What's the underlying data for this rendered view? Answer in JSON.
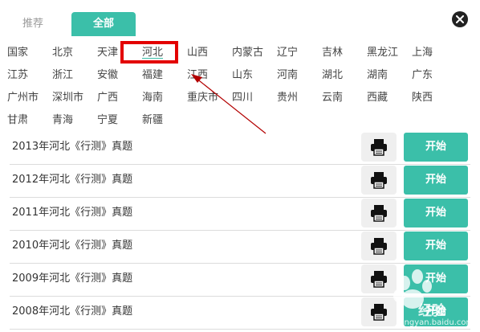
{
  "tabs": {
    "recommend": "推荐",
    "all": "全部"
  },
  "regions": [
    {
      "label": "国家",
      "row": 0,
      "col": 0
    },
    {
      "label": "北京",
      "row": 0,
      "col": 1
    },
    {
      "label": "天津",
      "row": 0,
      "col": 2
    },
    {
      "label": "河北",
      "row": 0,
      "col": 3,
      "selected": true
    },
    {
      "label": "山西",
      "row": 0,
      "col": 4
    },
    {
      "label": "内蒙古",
      "row": 0,
      "col": 5
    },
    {
      "label": "辽宁",
      "row": 0,
      "col": 6
    },
    {
      "label": "吉林",
      "row": 0,
      "col": 7
    },
    {
      "label": "黑龙江",
      "row": 0,
      "col": 8
    },
    {
      "label": "上海",
      "row": 0,
      "col": 9
    },
    {
      "label": "江苏",
      "row": 1,
      "col": 0
    },
    {
      "label": "浙江",
      "row": 1,
      "col": 1
    },
    {
      "label": "安徽",
      "row": 1,
      "col": 2
    },
    {
      "label": "福建",
      "row": 1,
      "col": 3
    },
    {
      "label": "江西",
      "row": 1,
      "col": 4
    },
    {
      "label": "山东",
      "row": 1,
      "col": 5
    },
    {
      "label": "河南",
      "row": 1,
      "col": 6
    },
    {
      "label": "湖北",
      "row": 1,
      "col": 7
    },
    {
      "label": "湖南",
      "row": 1,
      "col": 8
    },
    {
      "label": "广东",
      "row": 1,
      "col": 9
    },
    {
      "label": "广州市",
      "row": 2,
      "col": 0
    },
    {
      "label": "深圳市",
      "row": 2,
      "col": 1
    },
    {
      "label": "广西",
      "row": 2,
      "col": 2
    },
    {
      "label": "海南",
      "row": 2,
      "col": 3
    },
    {
      "label": "重庆市",
      "row": 2,
      "col": 4
    },
    {
      "label": "四川",
      "row": 2,
      "col": 5
    },
    {
      "label": "贵州",
      "row": 2,
      "col": 6
    },
    {
      "label": "云南",
      "row": 2,
      "col": 7
    },
    {
      "label": "西藏",
      "row": 2,
      "col": 8
    },
    {
      "label": "陕西",
      "row": 2,
      "col": 9
    },
    {
      "label": "甘肃",
      "row": 3,
      "col": 0
    },
    {
      "label": "青海",
      "row": 3,
      "col": 1
    },
    {
      "label": "宁夏",
      "row": 3,
      "col": 2
    },
    {
      "label": "新疆",
      "row": 3,
      "col": 3
    }
  ],
  "exams": [
    {
      "title": "2013年河北《行测》真题",
      "start": "开始"
    },
    {
      "title": "2012年河北《行测》真题",
      "start": "开始"
    },
    {
      "title": "2011年河北《行测》真题",
      "start": "开始"
    },
    {
      "title": "2010年河北《行测》真题",
      "start": "开始"
    },
    {
      "title": "2009年河北《行测》真题",
      "start": "开始"
    },
    {
      "title": "2008年河北《行测》真题",
      "start": "开始"
    }
  ],
  "watermark": {
    "text": "经验",
    "url": "jingyan.baidu.com"
  },
  "colors": {
    "accent": "#3bbfa9",
    "highlight": "#e30000"
  }
}
